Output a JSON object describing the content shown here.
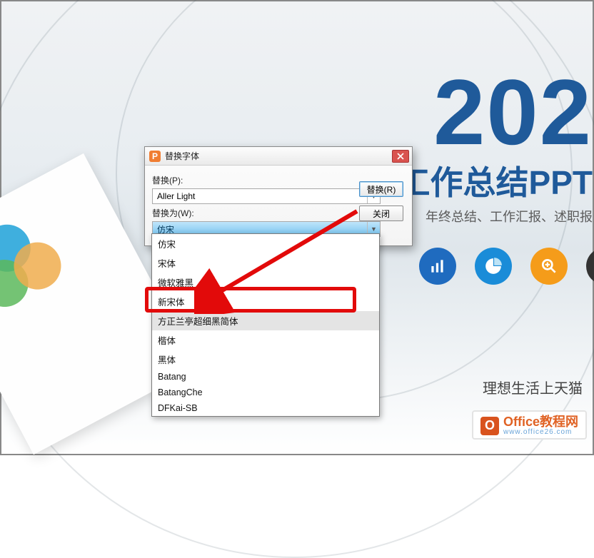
{
  "slide": {
    "headline": "202",
    "subtitle": "工作总结PPT",
    "subtext": "年终总结、工作汇报、述职报",
    "tagline": "理想生活上天猫"
  },
  "logo": {
    "brand": "Office教程网",
    "url": "www.office26.com",
    "mark": "O"
  },
  "dialog": {
    "title": "替换字体",
    "replace_label": "替换(P):",
    "replace_value": "Aller Light",
    "with_label": "替换为(W):",
    "with_value": "仿宋",
    "replace_button": "替换(R)",
    "close_button": "关闭"
  },
  "font_options": [
    "仿宋",
    "宋体",
    "微软雅黑",
    "新宋体",
    "方正兰亭超细黑简体",
    "楷体",
    "黑体",
    "Batang",
    "BatangChe",
    "DFKai-SB"
  ],
  "highlighted_index": 4
}
